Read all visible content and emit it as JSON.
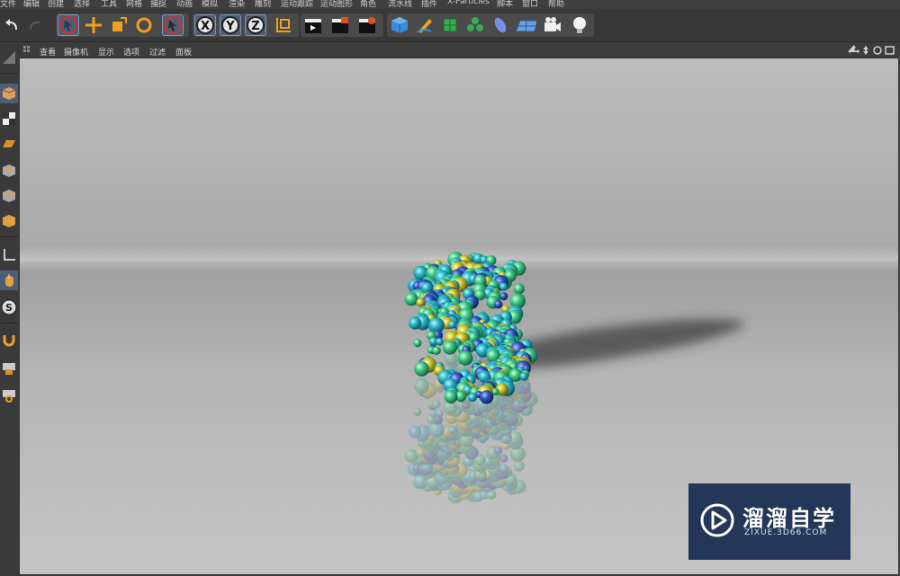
{
  "menubar": [
    "文件",
    "编辑",
    "创建",
    "选择",
    "工具",
    "网格",
    "捕捉",
    "动画",
    "模拟",
    "渲染",
    "雕刻",
    "运动跟踪",
    "运动图形",
    "角色",
    "流水线",
    "插件",
    "X-Particles",
    "脚本",
    "窗口",
    "帮助"
  ],
  "toolbar": {
    "undo": "undo-icon",
    "redo": "redo-icon",
    "axis_x": "X",
    "axis_y": "Y",
    "axis_z": "Z"
  },
  "viewport": {
    "menu": [
      "查看",
      "摄像机",
      "显示",
      "选项",
      "过滤",
      "面板"
    ],
    "nav_icons": [
      "move-view-icon",
      "zoom-view-icon",
      "rotate-view-icon",
      "maximize-view-icon"
    ]
  },
  "watermark": {
    "title": "溜溜自学",
    "subtitle": "ZIXUE.3D66.COM"
  },
  "colors": {
    "ui_bg": "#383838",
    "selected": "#4d5e75",
    "watermark_bg": "#243758",
    "accent_orange": "#f0a020"
  }
}
